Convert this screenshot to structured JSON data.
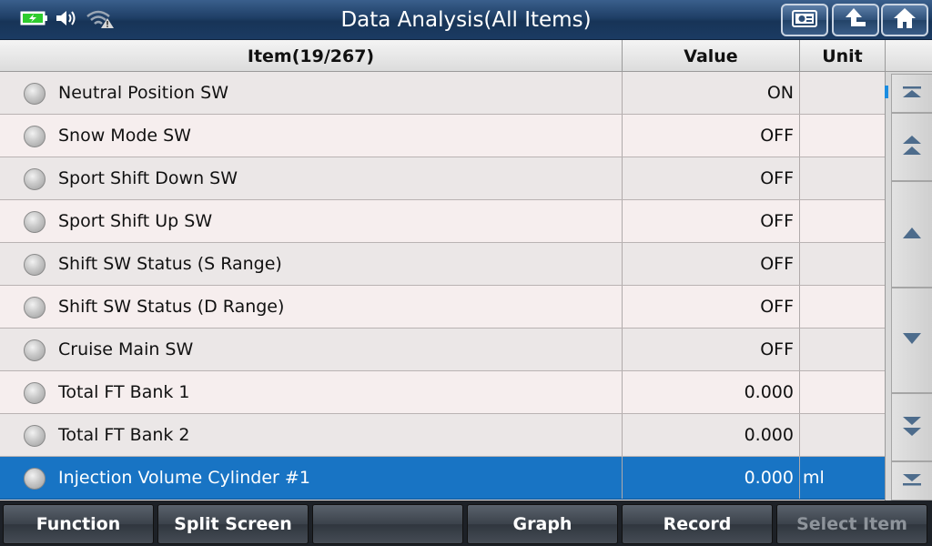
{
  "header": {
    "title": "Data Analysis(All Items)",
    "status_icons": [
      "battery-charging-icon",
      "speaker-icon",
      "wifi-warning-icon"
    ],
    "buttons": [
      "screenshot-icon",
      "back-arrow-icon",
      "home-icon"
    ]
  },
  "table": {
    "columns": {
      "item": "Item(19/267)",
      "value": "Value",
      "unit": "Unit"
    },
    "rows": [
      {
        "item": "Neutral Position SW",
        "value": "ON",
        "unit": ""
      },
      {
        "item": "Snow Mode SW",
        "value": "OFF",
        "unit": ""
      },
      {
        "item": "Sport Shift Down SW",
        "value": "OFF",
        "unit": ""
      },
      {
        "item": "Sport Shift Up SW",
        "value": "OFF",
        "unit": ""
      },
      {
        "item": "Shift SW Status (S Range)",
        "value": "OFF",
        "unit": ""
      },
      {
        "item": "Shift SW Status (D Range)",
        "value": "OFF",
        "unit": ""
      },
      {
        "item": "Cruise Main SW",
        "value": "OFF",
        "unit": ""
      },
      {
        "item": "Total FT Bank 1",
        "value": "0.000",
        "unit": ""
      },
      {
        "item": "Total FT Bank 2",
        "value": "0.000",
        "unit": ""
      },
      {
        "item": "Injection Volume Cylinder #1",
        "value": "0.000",
        "unit": "ml"
      }
    ],
    "selected_index": 9
  },
  "scroll_buttons": [
    "scroll-top-icon",
    "page-up-icon",
    "line-up-icon",
    "line-down-icon",
    "page-down-icon",
    "scroll-bottom-icon"
  ],
  "footer": {
    "buttons": [
      "Function",
      "Split Screen",
      "",
      "Graph",
      "Record",
      "Select Item"
    ],
    "disabled": [
      false,
      false,
      false,
      false,
      false,
      true
    ]
  },
  "colors": {
    "selected_row": "#1874c4",
    "title_bar": "#1f3f66",
    "battery": "#2ecc2e",
    "scroll_indicator": "#1a8ce0"
  }
}
